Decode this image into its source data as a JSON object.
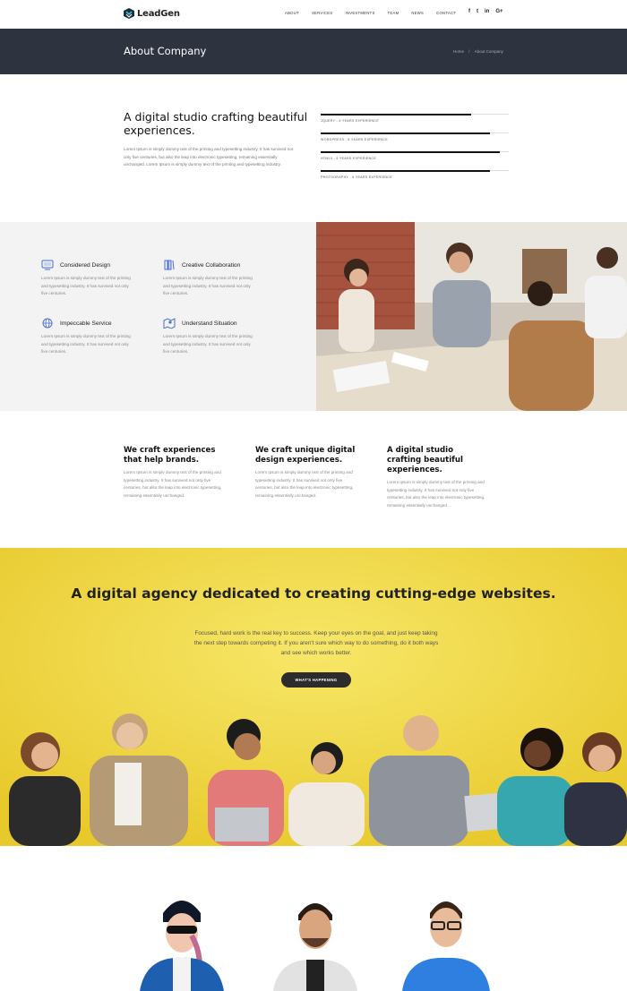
{
  "header": {
    "logo_text": "LeadGen",
    "nav": [
      "ABOUT",
      "SERVICES",
      "INVESTMENTS",
      "TEAM",
      "NEWS",
      "CONTACT"
    ],
    "socials": [
      "f",
      "t",
      "in",
      "G+"
    ]
  },
  "titlebar": {
    "title": "About Company",
    "breadcrumb": [
      "Home",
      "/",
      "About Company"
    ]
  },
  "intro": {
    "title": "A digital studio crafting beautiful experiences.",
    "text": "Lorem Ipsum is simply dummy text of the printing and typesetting industry. It has survived not only five centuries, but also the leap into electronic typesetting, remaining essentially unchanged. Lorem Ipsum is simply dummy text of the printing and typesetting industry."
  },
  "skills": [
    {
      "label": "JQUERY - 4 YEARS EXPERIENCE",
      "level": 0.8
    },
    {
      "label": "WORDPRESS - 6 YEARS EXPERIENCE",
      "level": 0.9
    },
    {
      "label": "HTML5 - 5 YEARS EXPERIENCE",
      "level": 0.95
    },
    {
      "label": "PHOTOGRAPHY - 6 YEARS EXPERIENCE",
      "level": 0.9
    }
  ],
  "features": [
    {
      "title": "Considered Design",
      "icon": "monitor-icon",
      "text": "Lorem Ipsum is simply dummy text of the printing and typesetting industry. It has survived not only five centuries."
    },
    {
      "title": "Creative Collaboration",
      "icon": "books-icon",
      "text": "Lorem Ipsum is simply dummy text of the printing and typesetting industry. It has survived not only five centuries."
    },
    {
      "title": "Impeccable Service",
      "icon": "globe-icon",
      "text": "Lorem Ipsum is simply dummy text of the printing and typesetting industry. It has survived not only five centuries."
    },
    {
      "title": "Understand Situation",
      "icon": "map-icon",
      "text": "Lorem Ipsum is simply dummy text of the printing and typesetting industry. It has survived not only five centuries."
    }
  ],
  "columns": [
    {
      "title": "We craft experiences that help brands.",
      "text": "Lorem Ipsum is simply dummy text of the printing and typesetting industry. It has survived not only five centuries, but also the leap into electronic typesetting, remaining essentially unchanged."
    },
    {
      "title": "We craft unique digital design experiences.",
      "text": "Lorem Ipsum is simply dummy text of the printing and typesetting industry. It has survived not only five centuries, but also the leap into electronic typesetting, remaining essentially unchanged."
    },
    {
      "title": "A digital studio crafting beautiful experiences.",
      "text": "Lorem Ipsum is simply dummy text of the printing and typesetting industry. It has survived not only five centuries, but also the leap into electronic typesetting, remaining essentially unchanged."
    }
  ],
  "cta": {
    "title": "A digital agency dedicated to creating cutting-edge websites.",
    "text": "Focused, hard work is the real key to success. Keep your eyes on the goal, and just keep taking the next step towards competing it. If you aren't sure which way to do something, do it both ways and see which works better.",
    "button_label": "WHAT'S HAPPENING"
  },
  "colors": {
    "dark_bar": "#2e3340",
    "yellow": "#f4dd3c",
    "feature_bg": "#f3f3f3",
    "icon_blue": "#4a6fd1"
  }
}
